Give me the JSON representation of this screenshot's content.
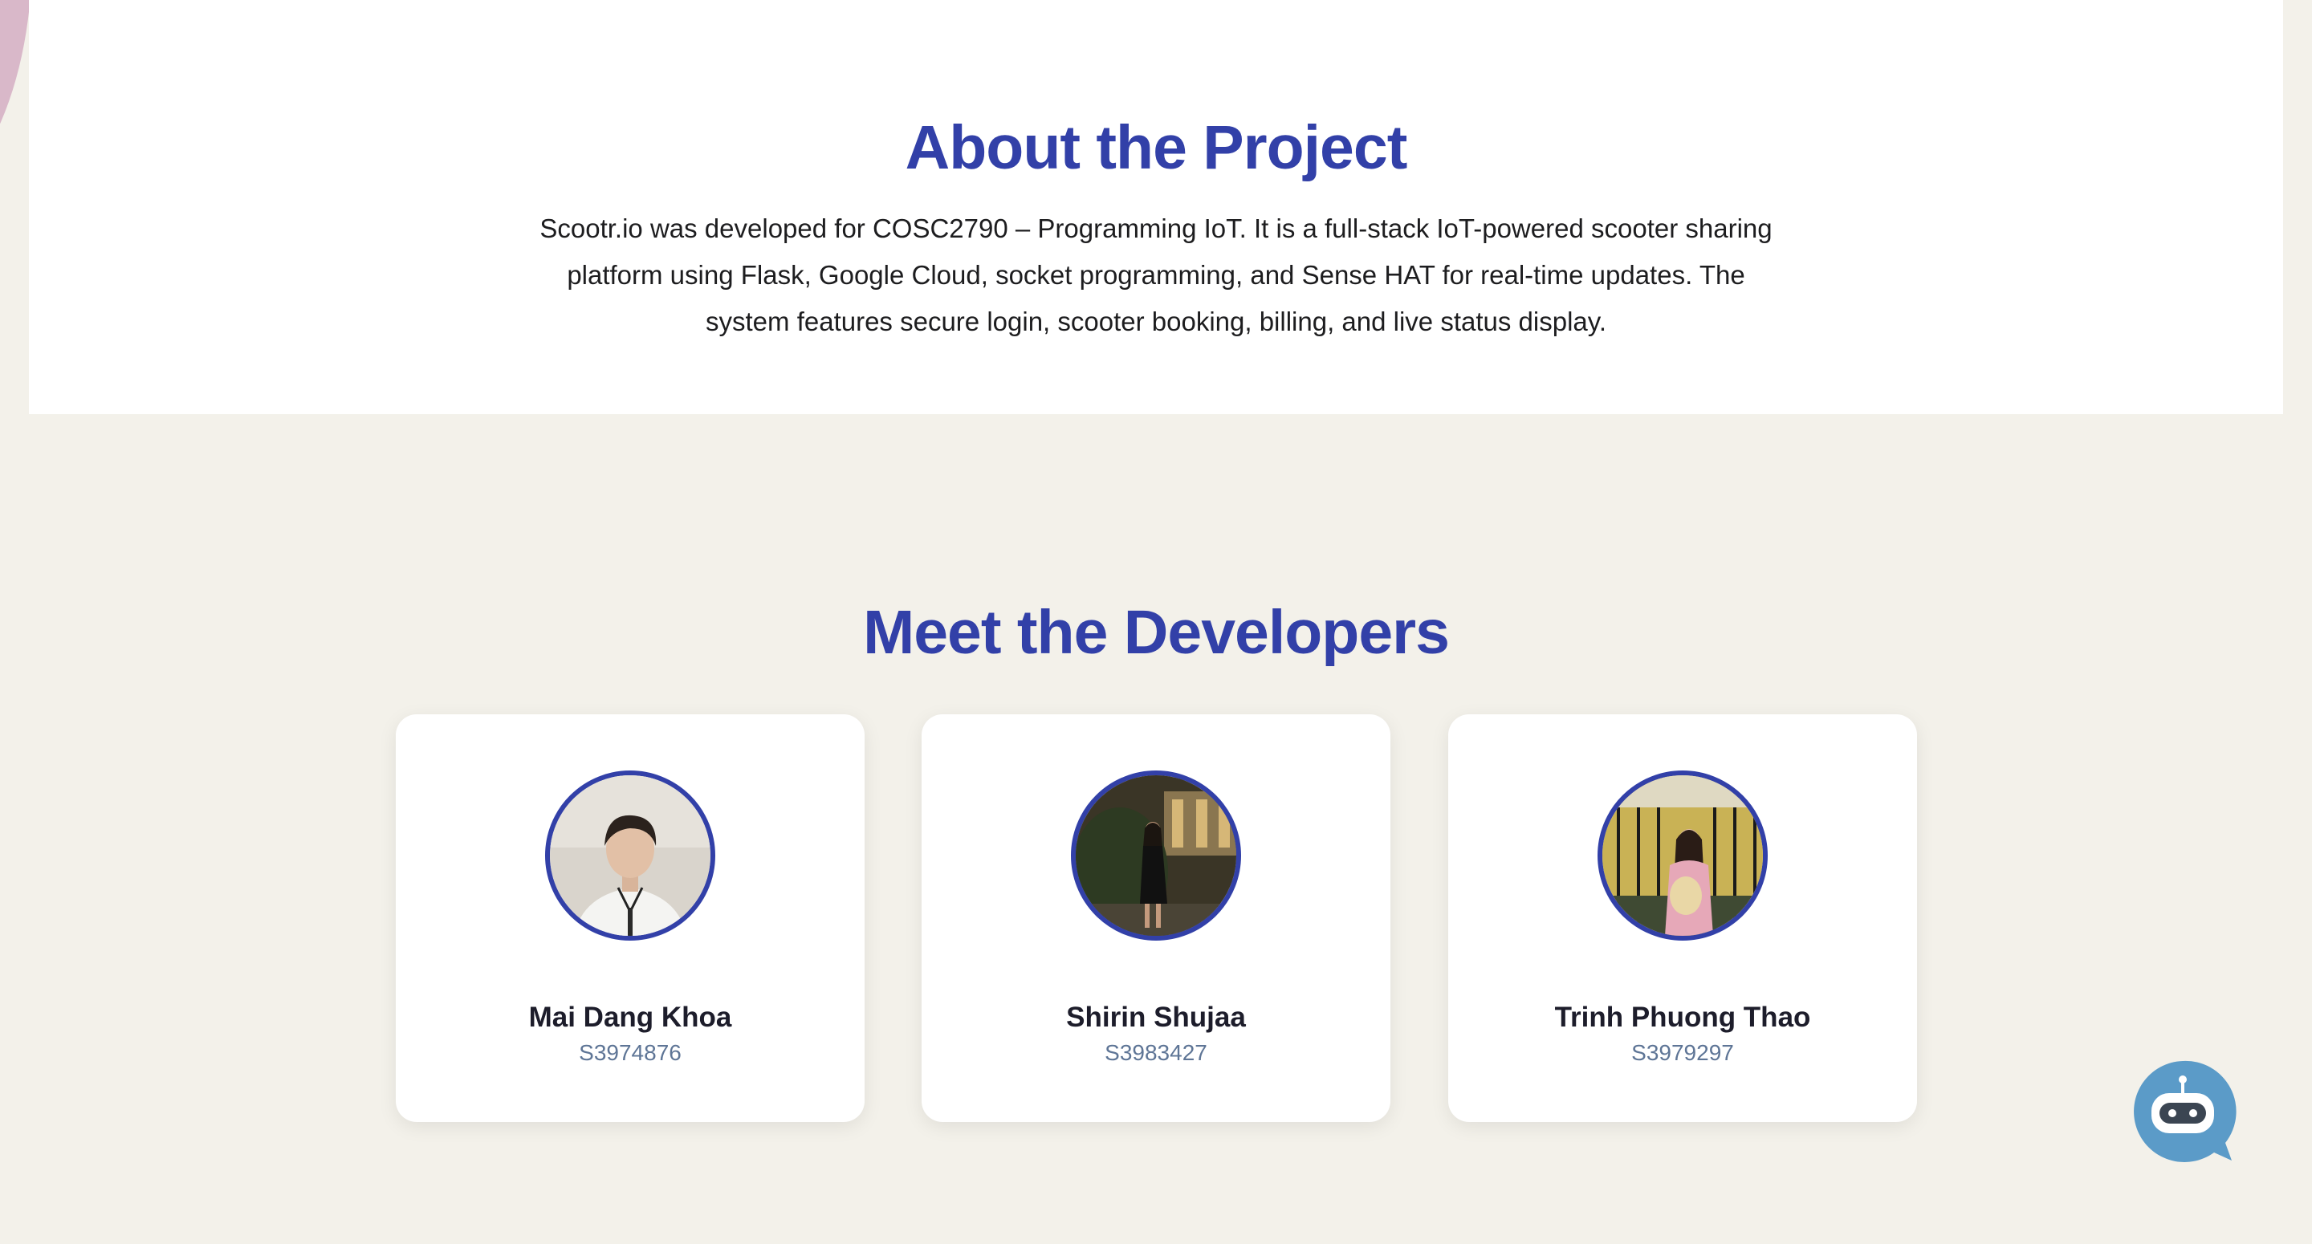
{
  "about": {
    "title": "About the Project",
    "text": "Scootr.io was developed for COSC2790 – Programming IoT. It is a full-stack IoT-powered scooter sharing platform using Flask, Google Cloud, socket programming, and Sense HAT for real-time updates. The system features secure login, scooter booking, billing, and live status display."
  },
  "developers": {
    "title": "Meet the Developers",
    "members": [
      {
        "name": "Mai Dang Khoa",
        "id": "S3974876"
      },
      {
        "name": "Shirin Shujaa",
        "id": "S3983427"
      },
      {
        "name": "Trinh Phuong Thao",
        "id": "S3979297"
      }
    ]
  },
  "chatbot": {
    "icon": "robot-icon"
  },
  "colors": {
    "accent": "#3240a8",
    "page_background": "#f3f1ea",
    "chatbot": "#5b9bc8"
  }
}
